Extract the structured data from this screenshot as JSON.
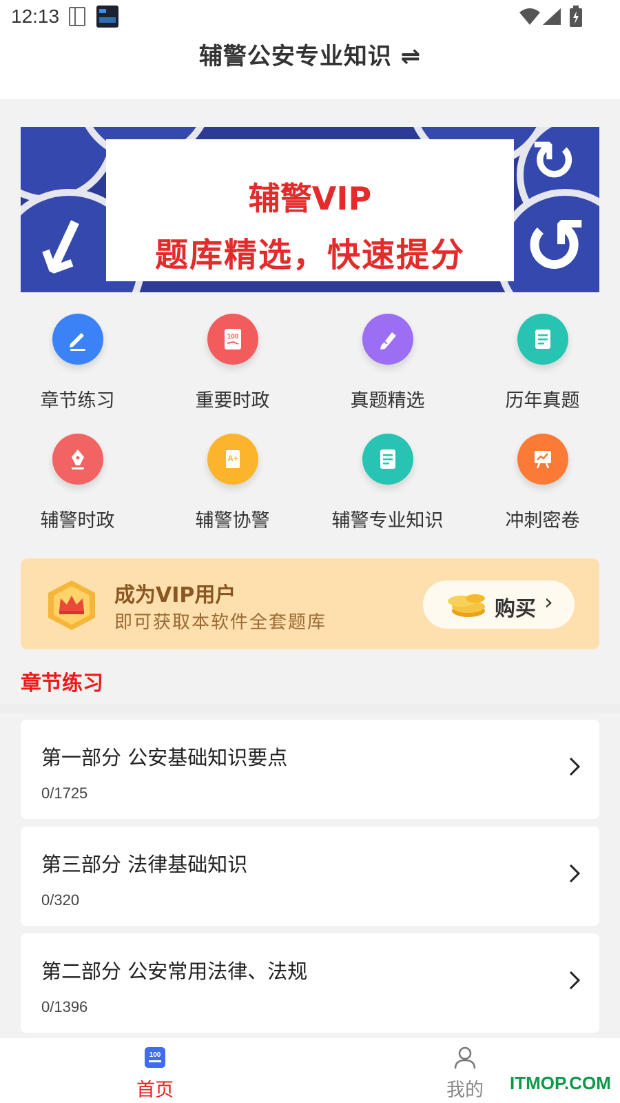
{
  "status_bar": {
    "time": "12:13"
  },
  "header": {
    "title": "辅警公安专业知识 ⇌"
  },
  "banner": {
    "line1": "辅警VIP",
    "line2": "题库精选，快速提分"
  },
  "grid": [
    {
      "label": "章节练习",
      "icon": "pencil-icon",
      "color": "#3b82f6"
    },
    {
      "label": "重要时政",
      "icon": "score-100-icon",
      "color": "#f25c5c"
    },
    {
      "label": "真题精选",
      "icon": "edit-pen-icon",
      "color": "#9b6ef3"
    },
    {
      "label": "历年真题",
      "icon": "document-icon",
      "color": "#27c3b3"
    },
    {
      "label": "辅警时政",
      "icon": "fountain-pen-icon",
      "color": "#f26363"
    },
    {
      "label": "辅警协警",
      "icon": "certificate-icon",
      "color": "#fbb42b"
    },
    {
      "label": "辅警专业知识",
      "icon": "notes-icon",
      "color": "#27c3b3"
    },
    {
      "label": "冲刺密卷",
      "icon": "chart-board-icon",
      "color": "#fb7a36"
    }
  ],
  "vip": {
    "title": "成为VIP用户",
    "subtitle": "即可获取本软件全套题库",
    "buy_label": "购买",
    "accent": "#fde0ad"
  },
  "section": {
    "title": "章节练习"
  },
  "chapters": [
    {
      "title": "第一部分 公安基础知识要点",
      "progress": "0/1725"
    },
    {
      "title": "第三部分 法律基础知识",
      "progress": "0/320"
    },
    {
      "title": "第二部分 公安常用法律、法规",
      "progress": "0/1396"
    }
  ],
  "tabbar": {
    "home": {
      "label": "首页",
      "color": "#ee1a1a"
    },
    "mine": {
      "label": "我的",
      "color": "#888888"
    }
  },
  "watermark": "ITMOP.COM"
}
